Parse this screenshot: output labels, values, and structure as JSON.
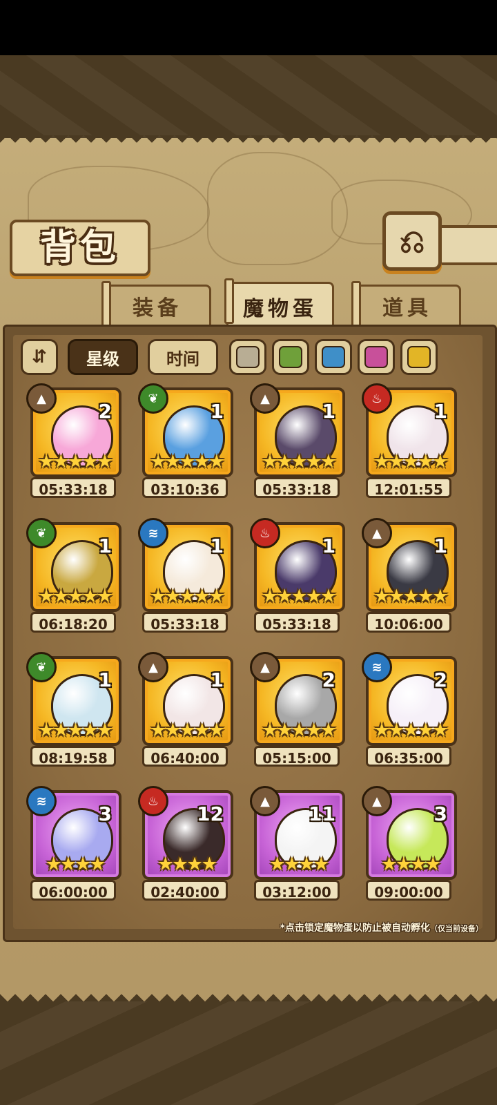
{
  "header": {
    "title": "背包",
    "back_icon": "⎌"
  },
  "tabs": [
    {
      "label": "装备",
      "active": false
    },
    {
      "label": "魔物蛋",
      "active": true
    },
    {
      "label": "道具",
      "active": false
    }
  ],
  "filters": {
    "sort_icon": "⇵",
    "star_label": "星级",
    "time_label": "时间",
    "colors": [
      "#b8ad94",
      "#6fa03a",
      "#3f8fc8",
      "#c8509a",
      "#e2b526"
    ]
  },
  "elements": {
    "earth": {
      "icon": "mountain-icon",
      "glyph": "▲",
      "color": "#7a5a3a"
    },
    "nature": {
      "icon": "leaf-icon",
      "glyph": "❦",
      "color": "#3e8a2a"
    },
    "fire": {
      "icon": "flame-icon",
      "glyph": "♨",
      "color": "#c62a22"
    },
    "water": {
      "icon": "wave-icon",
      "glyph": "≋",
      "color": "#2a78c0"
    }
  },
  "eggs": [
    {
      "count": "2",
      "element": "earth",
      "stars": "★★★★★",
      "time": "05:33:18",
      "rarity": "gold",
      "color": "#f7a8d8"
    },
    {
      "count": "1",
      "element": "nature",
      "stars": "★★★★★",
      "time": "03:10:36",
      "rarity": "gold",
      "color": "#5aa0e0"
    },
    {
      "count": "1",
      "element": "earth",
      "stars": "★★★★★",
      "time": "05:33:18",
      "rarity": "gold",
      "color": "#5a4a6a"
    },
    {
      "count": "1",
      "element": "fire",
      "stars": "★★★★★",
      "time": "12:01:55",
      "rarity": "gold",
      "color": "#f0e4ea"
    },
    {
      "count": "1",
      "element": "nature",
      "stars": "★★★★★",
      "time": "06:18:20",
      "rarity": "gold",
      "color": "#c9a840"
    },
    {
      "count": "1",
      "element": "water",
      "stars": "★★★★★",
      "time": "05:33:18",
      "rarity": "gold",
      "color": "#f5eadb"
    },
    {
      "count": "1",
      "element": "fire",
      "stars": "★★★★★",
      "time": "05:33:18",
      "rarity": "gold",
      "color": "#4a3a6a"
    },
    {
      "count": "1",
      "element": "earth",
      "stars": "★★★★★",
      "time": "10:06:00",
      "rarity": "gold",
      "color": "#3a3a44"
    },
    {
      "count": "1",
      "element": "nature",
      "stars": "★★★★★",
      "time": "08:19:58",
      "rarity": "gold",
      "color": "#cfe6f0"
    },
    {
      "count": "1",
      "element": "earth",
      "stars": "★★★★★",
      "time": "06:40:00",
      "rarity": "gold",
      "color": "#f2e6e6"
    },
    {
      "count": "2",
      "element": "earth",
      "stars": "★★★★★",
      "time": "05:15:00",
      "rarity": "gold",
      "color": "#a8a8a8"
    },
    {
      "count": "2",
      "element": "water",
      "stars": "★★★★★",
      "time": "06:35:00",
      "rarity": "gold",
      "color": "#f6f0f8"
    },
    {
      "count": "3",
      "element": "water",
      "stars": "★★★★",
      "time": "06:00:00",
      "rarity": "purple",
      "color": "#a8aaf0"
    },
    {
      "count": "12",
      "element": "fire",
      "stars": "★★★★",
      "time": "02:40:00",
      "rarity": "purple",
      "color": "#3a2a2a"
    },
    {
      "count": "11",
      "element": "earth",
      "stars": "★★★★",
      "time": "03:12:00",
      "rarity": "purple",
      "color": "#f4f4f4"
    },
    {
      "count": "3",
      "element": "earth",
      "stars": "★★★★",
      "time": "09:00:00",
      "rarity": "purple",
      "color": "#c6e85a"
    }
  ],
  "footer_note": "*点击锁定魔物蛋以防止被自动孵化",
  "footer_note_small": "（仅当前设备）"
}
